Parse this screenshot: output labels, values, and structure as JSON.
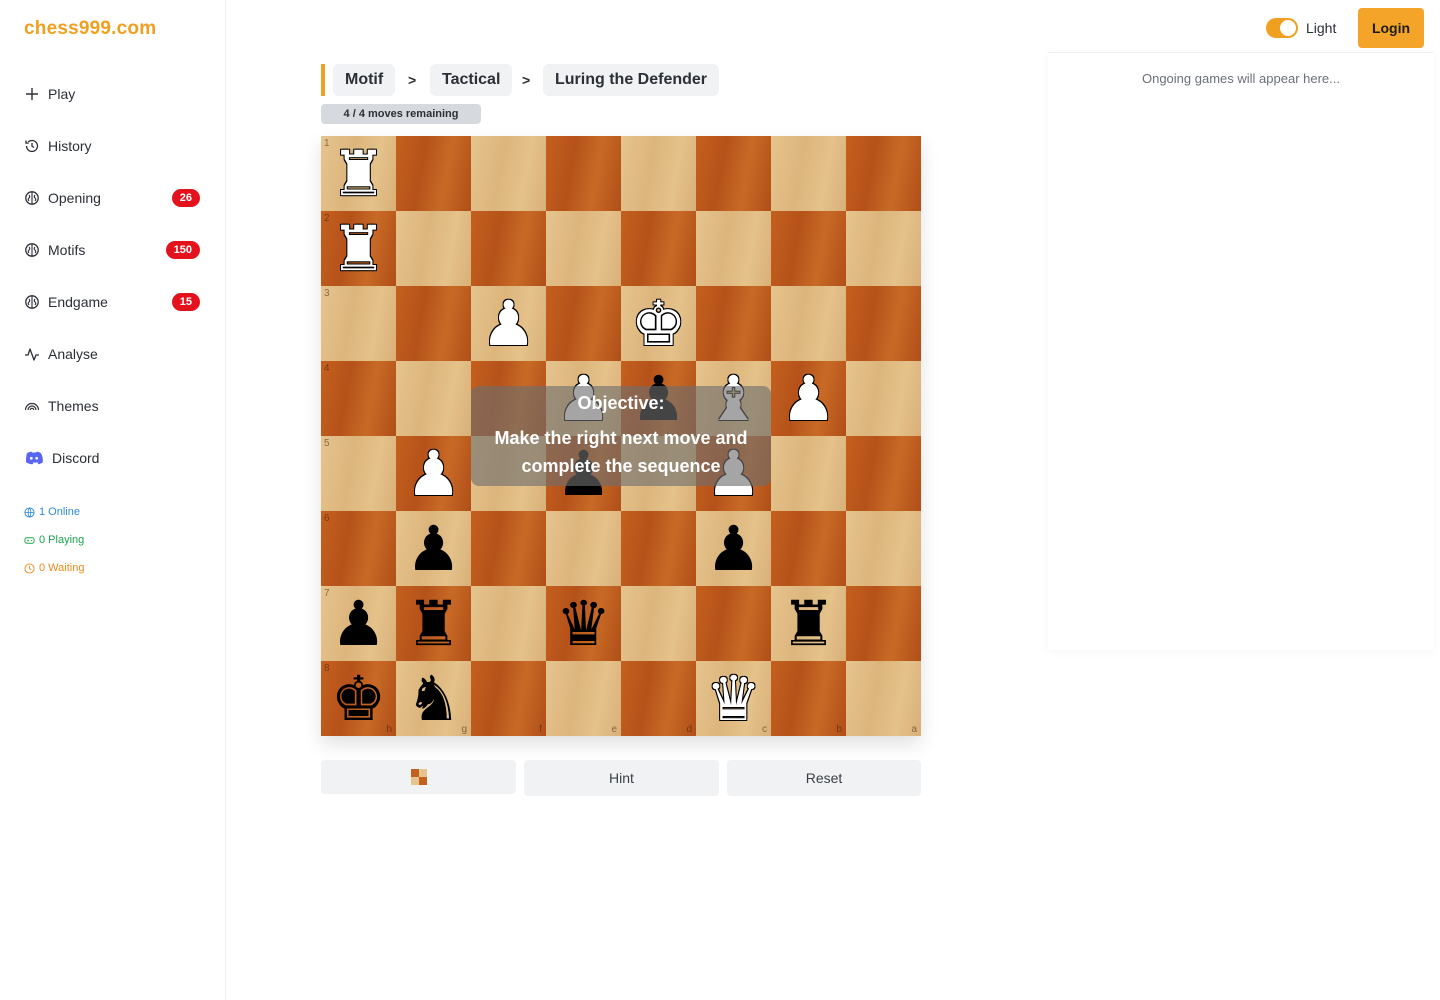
{
  "brand": {
    "logo": "chess999.com",
    "accent": "#f0a020"
  },
  "sidebar": {
    "items": [
      {
        "name": "play",
        "label": "Play",
        "icon": "plus-icon",
        "badge": null
      },
      {
        "name": "history",
        "label": "History",
        "icon": "history-icon",
        "badge": null
      },
      {
        "name": "opening",
        "label": "Opening",
        "icon": "brain-icon",
        "badge": "26"
      },
      {
        "name": "motifs",
        "label": "Motifs",
        "icon": "brain-icon",
        "badge": "150"
      },
      {
        "name": "endgame",
        "label": "Endgame",
        "icon": "brain-icon",
        "badge": "15"
      },
      {
        "name": "analyse",
        "label": "Analyse",
        "icon": "activity-icon",
        "badge": null
      },
      {
        "name": "themes",
        "label": "Themes",
        "icon": "rainbow-icon",
        "badge": null
      },
      {
        "name": "discord",
        "label": "Discord",
        "icon": "discord-icon",
        "badge": null
      }
    ],
    "stats": {
      "online": "1 Online",
      "playing": "0 Playing",
      "waiting": "0 Waiting"
    }
  },
  "header": {
    "theme_label": "Light",
    "theme_on": true,
    "login_label": "Login"
  },
  "right_panel": {
    "ongoing_text": "Ongoing games will appear here..."
  },
  "breadcrumb": {
    "items": [
      "Motif",
      "Tactical",
      "Luring the Defender"
    ],
    "separator": ">"
  },
  "puzzle": {
    "moves_remaining": "4 / 4 moves remaining",
    "objective_title": "Objective:",
    "objective_text": "Make the right next move and complete the sequence",
    "ranks": [
      "1",
      "2",
      "3",
      "4",
      "5",
      "6",
      "7",
      "8"
    ],
    "files": [
      "h",
      "g",
      "f",
      "e",
      "d",
      "c",
      "b",
      "a"
    ],
    "pieces": [
      {
        "row": 0,
        "col": 0,
        "color": "white",
        "type": "rook"
      },
      {
        "row": 1,
        "col": 0,
        "color": "white",
        "type": "rook"
      },
      {
        "row": 2,
        "col": 2,
        "color": "white",
        "type": "pawn"
      },
      {
        "row": 2,
        "col": 4,
        "color": "white",
        "type": "king"
      },
      {
        "row": 3,
        "col": 3,
        "color": "white",
        "type": "pawn"
      },
      {
        "row": 3,
        "col": 4,
        "color": "black",
        "type": "pawn"
      },
      {
        "row": 3,
        "col": 5,
        "color": "white",
        "type": "bishop"
      },
      {
        "row": 3,
        "col": 6,
        "color": "white",
        "type": "pawn"
      },
      {
        "row": 4,
        "col": 1,
        "color": "white",
        "type": "pawn"
      },
      {
        "row": 4,
        "col": 3,
        "color": "black",
        "type": "pawn"
      },
      {
        "row": 4,
        "col": 5,
        "color": "white",
        "type": "pawn"
      },
      {
        "row": 5,
        "col": 1,
        "color": "black",
        "type": "pawn"
      },
      {
        "row": 5,
        "col": 5,
        "color": "black",
        "type": "pawn"
      },
      {
        "row": 6,
        "col": 0,
        "color": "black",
        "type": "pawn"
      },
      {
        "row": 6,
        "col": 1,
        "color": "black",
        "type": "rook"
      },
      {
        "row": 6,
        "col": 3,
        "color": "black",
        "type": "queen"
      },
      {
        "row": 6,
        "col": 6,
        "color": "black",
        "type": "rook"
      },
      {
        "row": 7,
        "col": 0,
        "color": "black",
        "type": "king"
      },
      {
        "row": 7,
        "col": 1,
        "color": "black",
        "type": "knight"
      },
      {
        "row": 7,
        "col": 5,
        "color": "white",
        "type": "queen"
      }
    ]
  },
  "controls": {
    "flip_icon": "board-flip-icon",
    "hint_label": "Hint",
    "reset_label": "Reset"
  },
  "colors": {
    "light_square": "#e6c48e",
    "dark_square": "#c4601e",
    "badge": "#e4121c",
    "online": "#2f8ad6",
    "playing": "#1aa54a",
    "waiting": "#f08a1c"
  }
}
